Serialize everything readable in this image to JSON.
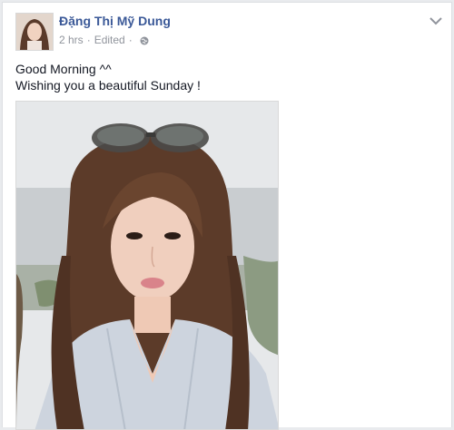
{
  "post": {
    "author": "Đặng Thị Mỹ Dung",
    "time": "2 hrs",
    "edited": "Edited",
    "separator": "·",
    "lines": [
      "Good Morning ^^",
      "Wishing you a beautiful Sunday !"
    ]
  },
  "icons": {
    "audience": "globe-icon",
    "menu": "chevron-down-icon"
  },
  "colors": {
    "author_link": "#3b5998",
    "meta_text": "#90949c",
    "body_text": "#141823"
  }
}
